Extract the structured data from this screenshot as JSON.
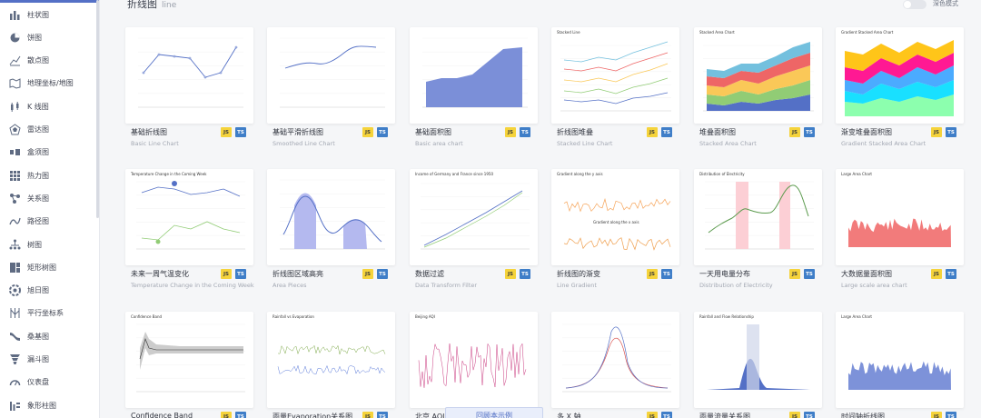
{
  "header": {
    "title": "折线图",
    "subtitle": "line",
    "dark_mode_label": "深色模式"
  },
  "sidebar": {
    "items": [
      {
        "label": "柱状图",
        "icon": "bar-chart-icon"
      },
      {
        "label": "饼图",
        "icon": "pie-chart-icon"
      },
      {
        "label": "散点图",
        "icon": "scatter-icon"
      },
      {
        "label": "地理坐标/地图",
        "icon": "map-icon"
      },
      {
        "label": "K 线图",
        "icon": "candlestick-icon"
      },
      {
        "label": "雷达图",
        "icon": "radar-icon"
      },
      {
        "label": "盒须图",
        "icon": "boxplot-icon"
      },
      {
        "label": "热力图",
        "icon": "heatmap-icon"
      },
      {
        "label": "关系图",
        "icon": "graph-icon"
      },
      {
        "label": "路径图",
        "icon": "lines-icon"
      },
      {
        "label": "树图",
        "icon": "tree-icon"
      },
      {
        "label": "矩形树图",
        "icon": "treemap-icon"
      },
      {
        "label": "旭日图",
        "icon": "sunburst-icon"
      },
      {
        "label": "平行坐标系",
        "icon": "parallel-icon"
      },
      {
        "label": "桑基图",
        "icon": "sankey-icon"
      },
      {
        "label": "漏斗图",
        "icon": "funnel-icon"
      },
      {
        "label": "仪表盘",
        "icon": "gauge-icon"
      },
      {
        "label": "象形柱图",
        "icon": "pictorial-bar-icon"
      }
    ]
  },
  "badges": {
    "js": "JS",
    "ts": "TS"
  },
  "cards": [
    {
      "title": "基础折线图",
      "subtitle": "Basic Line Chart"
    },
    {
      "title": "基础平滑折线图",
      "subtitle": "Smoothed Line Chart"
    },
    {
      "title": "基础面积图",
      "subtitle": "Basic area chart"
    },
    {
      "title": "折线图堆叠",
      "subtitle": "Stacked Line Chart",
      "thumb_title": "Stacked Line"
    },
    {
      "title": "堆叠面积图",
      "subtitle": "Stacked Area Chart",
      "thumb_title": "Stacked Area Chart"
    },
    {
      "title": "渐变堆叠面积图",
      "subtitle": "Gradient Stacked Area Chart",
      "thumb_title": "Gradient Stacked Area Chart"
    },
    {
      "title": "未来一周气温变化",
      "subtitle": "Temperature Change in the Coming Week",
      "thumb_title": "Temperature Change in the Coming Week"
    },
    {
      "title": "折线图区域高亮",
      "subtitle": "Area Pieces"
    },
    {
      "title": "数据过滤",
      "subtitle": "Data Transform Filter",
      "thumb_title": "Income of Germany and France since 1950"
    },
    {
      "title": "折线图的渐变",
      "subtitle": "Line Gradient",
      "thumb_title": "Gradient along the y axis",
      "thumb_title_2": "Gradient along the x axis"
    },
    {
      "title": "一天用电量分布",
      "subtitle": "Distribution of Electricity",
      "thumb_title": "Distribution of Electricity"
    },
    {
      "title": "大数据量面积图",
      "subtitle": "Large scale area chart",
      "thumb_title": "Large Area Chart"
    },
    {
      "title": "Confidence Band",
      "subtitle": "",
      "thumb_title": "Confidence Band"
    },
    {
      "title": "雨量Evaporation关系图",
      "subtitle": "",
      "thumb_title": "Rainfall vs Evaporation"
    },
    {
      "title": "北京 AQI",
      "subtitle": "",
      "thumb_title": "Beijing AQI"
    },
    {
      "title": "多 X 轴",
      "subtitle": ""
    },
    {
      "title": "雨量流量关系图",
      "subtitle": "",
      "thumb_title": "Rainfall and Flow Relationship"
    },
    {
      "title": "时间轴折线图",
      "subtitle": "",
      "thumb_title": "Large Area Chart"
    }
  ],
  "floating_button": "回顾本示例"
}
